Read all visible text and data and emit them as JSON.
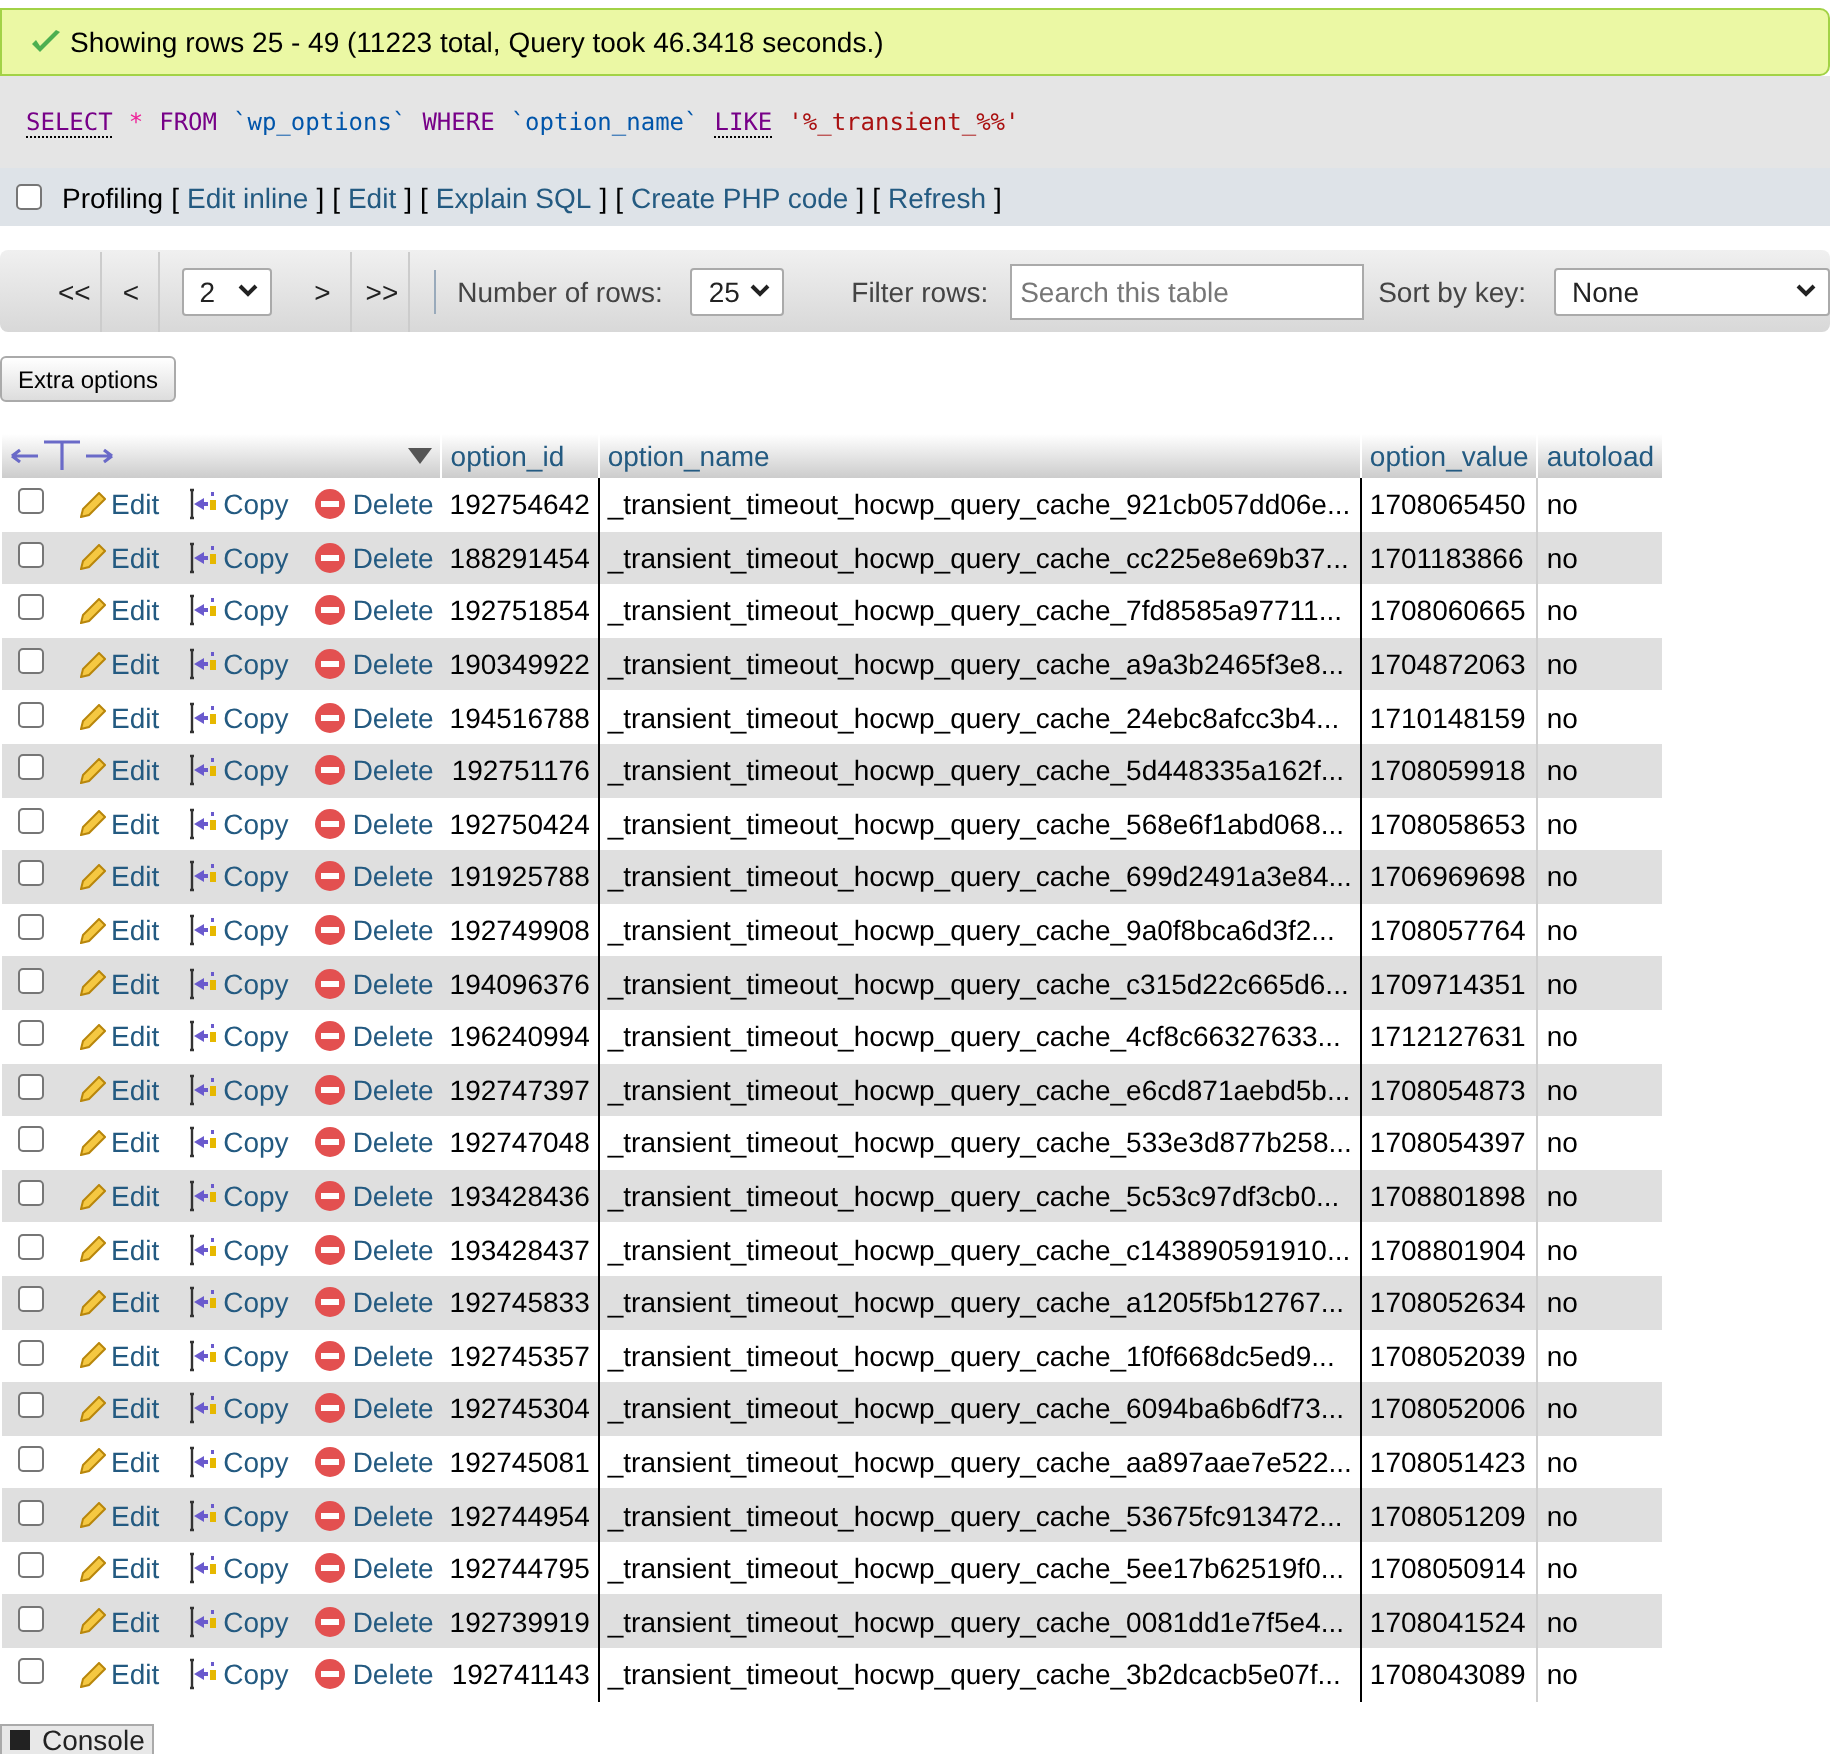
{
  "message": {
    "text": "Showing rows 25 - 49 (11223 total, Query took 46.3418 seconds.)"
  },
  "sql": [
    {
      "text": "SELECT",
      "kind": "doc"
    },
    {
      "text": "*",
      "kind": "operator"
    },
    {
      "text": "FROM",
      "kind": "keyword"
    },
    {
      "text": "`wp_options`",
      "kind": "identifier"
    },
    {
      "text": "WHERE",
      "kind": "keyword"
    },
    {
      "text": "`option_name`",
      "kind": "identifier"
    },
    {
      "text": "LIKE",
      "kind": "doc"
    },
    {
      "text": "'%_transient_%%'",
      "kind": "string"
    }
  ],
  "profiling": {
    "label": "Profiling",
    "checked": false,
    "links": [
      {
        "open": "[",
        "label": "Edit inline",
        "close": "]"
      },
      {
        "open": "[",
        "label": "Edit",
        "close": "]"
      },
      {
        "open": "[",
        "label": "Explain SQL",
        "close": "]"
      },
      {
        "open": "[",
        "label": "Create PHP code",
        "close": "]"
      },
      {
        "open": "[",
        "label": "Refresh",
        "close": "]"
      }
    ]
  },
  "navigation": {
    "first": "<<",
    "prev": "<",
    "page": "2",
    "next": ">",
    "last": ">>",
    "rows_label": "Number of rows:",
    "rows_value": "25",
    "filter_label": "Filter rows:",
    "filter_placeholder": "Search this table",
    "sort_label": "Sort by key:",
    "sort_value": "None"
  },
  "extra_options": "Extra options",
  "table": {
    "columns": [
      "option_id",
      "option_name",
      "option_value",
      "autoload"
    ],
    "rows": [
      {
        "checked": false,
        "edit": "Edit",
        "copy": "Copy",
        "delete": "Delete",
        "cells": [
          "192754642",
          "_transient_timeout_hocwp_query_cache_921cb057dd06e...",
          "1708065450",
          "no"
        ]
      },
      {
        "checked": false,
        "edit": "Edit",
        "copy": "Copy",
        "delete": "Delete",
        "cells": [
          "188291454",
          "_transient_timeout_hocwp_query_cache_cc225e8e69b37...",
          "1701183866",
          "no"
        ]
      },
      {
        "checked": false,
        "edit": "Edit",
        "copy": "Copy",
        "delete": "Delete",
        "cells": [
          "192751854",
          "_transient_timeout_hocwp_query_cache_7fd8585a97711...",
          "1708060665",
          "no"
        ]
      },
      {
        "checked": false,
        "edit": "Edit",
        "copy": "Copy",
        "delete": "Delete",
        "cells": [
          "190349922",
          "_transient_timeout_hocwp_query_cache_a9a3b2465f3e8...",
          "1704872063",
          "no"
        ]
      },
      {
        "checked": false,
        "edit": "Edit",
        "copy": "Copy",
        "delete": "Delete",
        "cells": [
          "194516788",
          "_transient_timeout_hocwp_query_cache_24ebc8afcc3b4...",
          "1710148159",
          "no"
        ]
      },
      {
        "checked": false,
        "edit": "Edit",
        "copy": "Copy",
        "delete": "Delete",
        "cells": [
          "192751176",
          "_transient_timeout_hocwp_query_cache_5d448335a162f...",
          "1708059918",
          "no"
        ]
      },
      {
        "checked": false,
        "edit": "Edit",
        "copy": "Copy",
        "delete": "Delete",
        "cells": [
          "192750424",
          "_transient_timeout_hocwp_query_cache_568e6f1abd068...",
          "1708058653",
          "no"
        ]
      },
      {
        "checked": false,
        "edit": "Edit",
        "copy": "Copy",
        "delete": "Delete",
        "cells": [
          "191925788",
          "_transient_timeout_hocwp_query_cache_699d2491a3e84...",
          "1706969698",
          "no"
        ]
      },
      {
        "checked": false,
        "edit": "Edit",
        "copy": "Copy",
        "delete": "Delete",
        "cells": [
          "192749908",
          "_transient_timeout_hocwp_query_cache_9a0f8bca6d3f2...",
          "1708057764",
          "no"
        ]
      },
      {
        "checked": false,
        "edit": "Edit",
        "copy": "Copy",
        "delete": "Delete",
        "cells": [
          "194096376",
          "_transient_timeout_hocwp_query_cache_c315d22c665d6...",
          "1709714351",
          "no"
        ]
      },
      {
        "checked": false,
        "edit": "Edit",
        "copy": "Copy",
        "delete": "Delete",
        "cells": [
          "196240994",
          "_transient_timeout_hocwp_query_cache_4cf8c66327633...",
          "1712127631",
          "no"
        ]
      },
      {
        "checked": false,
        "edit": "Edit",
        "copy": "Copy",
        "delete": "Delete",
        "cells": [
          "192747397",
          "_transient_timeout_hocwp_query_cache_e6cd871aebd5b...",
          "1708054873",
          "no"
        ]
      },
      {
        "checked": false,
        "edit": "Edit",
        "copy": "Copy",
        "delete": "Delete",
        "cells": [
          "192747048",
          "_transient_timeout_hocwp_query_cache_533e3d877b258...",
          "1708054397",
          "no"
        ]
      },
      {
        "checked": false,
        "edit": "Edit",
        "copy": "Copy",
        "delete": "Delete",
        "cells": [
          "193428436",
          "_transient_timeout_hocwp_query_cache_5c53c97df3cb0...",
          "1708801898",
          "no"
        ]
      },
      {
        "checked": false,
        "edit": "Edit",
        "copy": "Copy",
        "delete": "Delete",
        "cells": [
          "193428437",
          "_transient_timeout_hocwp_query_cache_c143890591910...",
          "1708801904",
          "no"
        ]
      },
      {
        "checked": false,
        "edit": "Edit",
        "copy": "Copy",
        "delete": "Delete",
        "cells": [
          "192745833",
          "_transient_timeout_hocwp_query_cache_a1205f5b12767...",
          "1708052634",
          "no"
        ]
      },
      {
        "checked": false,
        "edit": "Edit",
        "copy": "Copy",
        "delete": "Delete",
        "cells": [
          "192745357",
          "_transient_timeout_hocwp_query_cache_1f0f668dc5ed9...",
          "1708052039",
          "no"
        ]
      },
      {
        "checked": false,
        "edit": "Edit",
        "copy": "Copy",
        "delete": "Delete",
        "cells": [
          "192745304",
          "_transient_timeout_hocwp_query_cache_6094ba6b6df73...",
          "1708052006",
          "no"
        ]
      },
      {
        "checked": false,
        "edit": "Edit",
        "copy": "Copy",
        "delete": "Delete",
        "cells": [
          "192745081",
          "_transient_timeout_hocwp_query_cache_aa897aae7e522...",
          "1708051423",
          "no"
        ]
      },
      {
        "checked": false,
        "edit": "Edit",
        "copy": "Copy",
        "delete": "Delete",
        "cells": [
          "192744954",
          "_transient_timeout_hocwp_query_cache_53675fc913472...",
          "1708051209",
          "no"
        ]
      },
      {
        "checked": false,
        "edit": "Edit",
        "copy": "Copy",
        "delete": "Delete",
        "cells": [
          "192744795",
          "_transient_timeout_hocwp_query_cache_5ee17b62519f0...",
          "1708050914",
          "no"
        ]
      },
      {
        "checked": false,
        "edit": "Edit",
        "copy": "Copy",
        "delete": "Delete",
        "cells": [
          "192739919",
          "_transient_timeout_hocwp_query_cache_0081dd1e7f5e4...",
          "1708041524",
          "no"
        ]
      },
      {
        "checked": false,
        "edit": "Edit",
        "copy": "Copy",
        "delete": "Delete",
        "cells": [
          "192741143",
          "_transient_timeout_hocwp_query_cache_3b2dcacb5e07f...",
          "1708043089",
          "no"
        ]
      }
    ]
  },
  "console": {
    "label": "Console"
  }
}
